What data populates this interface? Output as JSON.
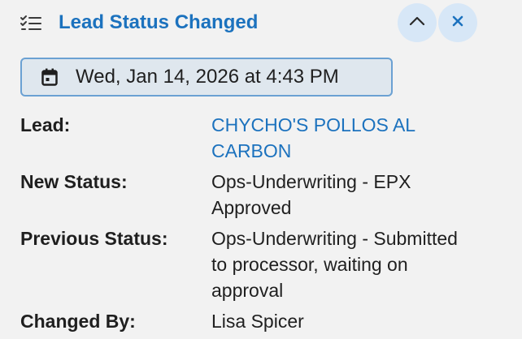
{
  "header": {
    "title": "Lead Status Changed",
    "icon": "task-list-icon",
    "collapse_icon": "chevron-up-icon",
    "close_icon": "close-icon"
  },
  "date": {
    "icon": "calendar-icon",
    "text": "Wed, Jan 14, 2026 at 4:43 PM"
  },
  "details": {
    "lead_label": "Lead:",
    "lead_value": "CHYCHO'S POLLOS AL CARBON",
    "new_status_label": "New Status:",
    "new_status_value": "Ops-Underwriting - EPX Approved",
    "previous_status_label": "Previous Status:",
    "previous_status_value": "Ops-Underwriting - Submitted to processor, waiting on approval",
    "changed_by_label": "Changed By:",
    "changed_by_value": "Lisa Spicer"
  },
  "colors": {
    "accent": "#1c72be",
    "button_bg": "#d7e7f7",
    "pill_border": "#6ba1d3",
    "pill_bg": "#dfe7ee",
    "background": "#f2f2f2"
  }
}
